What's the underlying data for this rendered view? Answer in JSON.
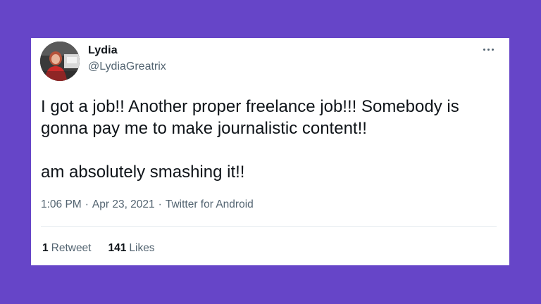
{
  "tweet": {
    "author": {
      "display_name": "Lydia",
      "handle": "@LydiaGreatrix"
    },
    "text": {
      "paragraph_1": "I got a job!! Another proper freelance job!!! Somebody is gonna pay me to make journalistic content!!",
      "paragraph_2": "am absolutely smashing it!!"
    },
    "meta": {
      "time": "1:06 PM",
      "separator": "·",
      "date": "Apr 23, 2021",
      "source": "Twitter for Android"
    },
    "stats": {
      "retweets_count": "1",
      "retweets_label": "Retweet",
      "likes_count": "141",
      "likes_label": "Likes"
    }
  },
  "colors": {
    "background": "#6645c8",
    "card": "#ffffff",
    "primary_text": "#0f1419",
    "secondary_text": "#536471"
  },
  "icons": {
    "more": "more-horizontal-icon"
  }
}
